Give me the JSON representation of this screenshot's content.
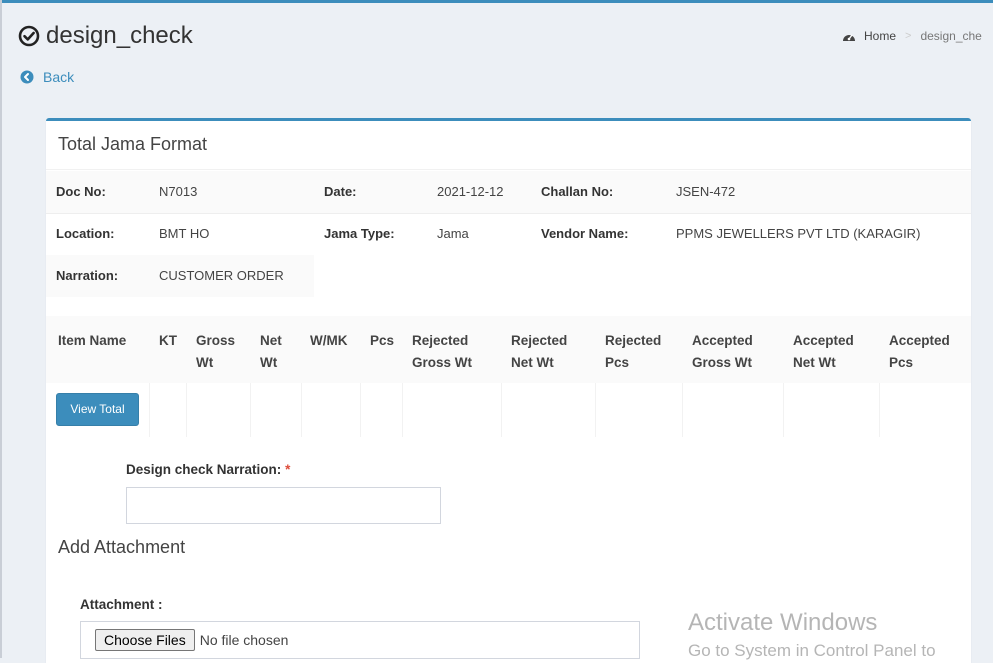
{
  "header": {
    "title": "design_check",
    "back_label": "Back"
  },
  "breadcrumb": {
    "home": "Home",
    "separator": ">",
    "current": "design_che"
  },
  "box": {
    "title": "Total Jama Format"
  },
  "info": {
    "doc_no_label": "Doc No:",
    "doc_no": "N7013",
    "date_label": "Date:",
    "date": "2021-12-12",
    "challan_label": "Challan No:",
    "challan": "JSEN-472",
    "location_label": "Location:",
    "location": "BMT HO",
    "jama_type_label": "Jama Type:",
    "jama_type": "Jama",
    "vendor_label": "Vendor Name:",
    "vendor": "PPMS JEWELLERS PVT LTD (KARAGIR)",
    "narration_label": "Narration:",
    "narration": "CUSTOMER ORDER"
  },
  "table": {
    "columns": [
      [
        "Item Name"
      ],
      [
        "KT"
      ],
      [
        "Gross",
        "Wt"
      ],
      [
        "Net",
        "Wt"
      ],
      [
        "W/MK"
      ],
      [
        "Pcs"
      ],
      [
        "Rejected",
        "Gross Wt"
      ],
      [
        "Rejected",
        "Net Wt"
      ],
      [
        "Rejected",
        "Pcs"
      ],
      [
        "Accepted",
        "Gross Wt"
      ],
      [
        "Accepted",
        "Net Wt"
      ],
      [
        "Accepted",
        "Pcs"
      ]
    ],
    "view_total_label": "View Total"
  },
  "form": {
    "narration_label": "Design check Narration:",
    "required_mark": "*",
    "attachment_section": "Add Attachment",
    "attachment_label": "Attachment :",
    "choose_files": "Choose Files",
    "no_file": "No file chosen"
  },
  "watermark": {
    "line1": "Activate Windows",
    "line2": "Go to System in Control Panel to"
  },
  "colors": {
    "accent": "#3c8dbc",
    "background": "#ecf0f5",
    "required": "#dd4b39"
  }
}
